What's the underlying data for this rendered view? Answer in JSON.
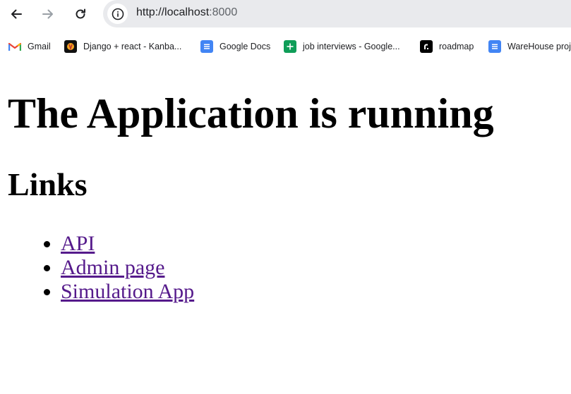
{
  "browser": {
    "url_host": "http://localhost",
    "url_port": ":8000"
  },
  "bookmarks": [
    {
      "label": "Gmail",
      "icon": "gmail-icon"
    },
    {
      "label": "Django + react - Kanba...",
      "icon": "django-icon"
    },
    {
      "label": "Google Docs",
      "icon": "google-docs-icon"
    },
    {
      "label": "job interviews - Google...",
      "icon": "google-sheets-icon"
    },
    {
      "label": "roadmap",
      "icon": "roadmap-icon"
    },
    {
      "label": "WareHouse proj",
      "icon": "google-docs-icon"
    }
  ],
  "page": {
    "heading": "The Application is running",
    "subheading": "Links",
    "links": [
      {
        "label": "API"
      },
      {
        "label": "Admin page"
      },
      {
        "label": "Simulation App"
      }
    ]
  },
  "colors": {
    "visited_link": "#551a8b",
    "omnibox_bg": "#e9eaed",
    "docs_blue": "#4285f4",
    "sheets_green": "#0f9d58"
  }
}
